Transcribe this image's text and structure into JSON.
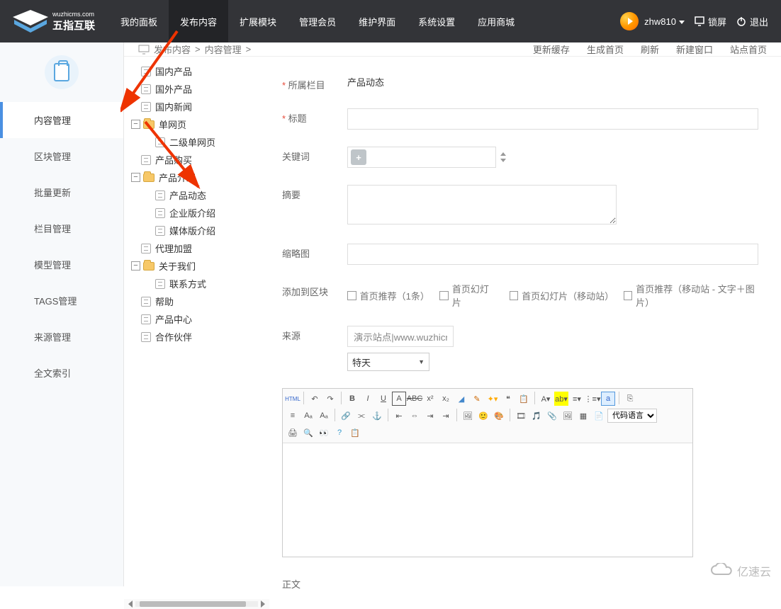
{
  "header": {
    "brand_sub": "wuzhicms.com",
    "brand": "五指互联",
    "nav": [
      "我的面板",
      "发布内容",
      "扩展模块",
      "管理会员",
      "维护界面",
      "系统设置",
      "应用商城"
    ],
    "active_nav": 1,
    "username": "zhw810",
    "lock_label": "锁屏",
    "logout_label": "退出"
  },
  "breadcrumb": [
    "发布内容",
    "内容管理"
  ],
  "sub_actions": [
    "更新缓存",
    "生成首页",
    "刷新",
    "新建窗口",
    "站点首页"
  ],
  "sidebar": {
    "items": [
      "内容管理",
      "区块管理",
      "批量更新",
      "栏目管理",
      "模型管理",
      "TAGS管理",
      "来源管理",
      "全文索引"
    ],
    "active": 0
  },
  "tree": [
    {
      "lvl": 1,
      "ico": "file",
      "label": "国内产品"
    },
    {
      "lvl": 1,
      "ico": "file",
      "label": "国外产品"
    },
    {
      "lvl": 1,
      "ico": "file",
      "label": "国内新闻"
    },
    {
      "lvl": 0,
      "ico": "folder",
      "toggle": "−",
      "label": "单网页"
    },
    {
      "lvl": 2,
      "ico": "file",
      "label": "二级单网页"
    },
    {
      "lvl": 1,
      "ico": "file",
      "label": "产品购买"
    },
    {
      "lvl": 0,
      "ico": "folder",
      "toggle": "−",
      "label": "产品介绍"
    },
    {
      "lvl": 2,
      "ico": "file",
      "label": "产品动态"
    },
    {
      "lvl": 2,
      "ico": "file",
      "label": "企业版介绍"
    },
    {
      "lvl": 2,
      "ico": "file",
      "label": "媒体版介绍"
    },
    {
      "lvl": 1,
      "ico": "file",
      "label": "代理加盟"
    },
    {
      "lvl": 0,
      "ico": "folder",
      "toggle": "−",
      "label": "关于我们"
    },
    {
      "lvl": 2,
      "ico": "file",
      "label": "联系方式"
    },
    {
      "lvl": 1,
      "ico": "file",
      "label": "帮助"
    },
    {
      "lvl": 1,
      "ico": "file",
      "label": "产品中心"
    },
    {
      "lvl": 1,
      "ico": "file",
      "label": "合作伙伴"
    }
  ],
  "form": {
    "category_label": "所属栏目",
    "category_value": "产品动态",
    "title_label": "标题",
    "keywords_label": "关键词",
    "summary_label": "摘要",
    "thumb_label": "缩略图",
    "block_label": "添加到区块",
    "blocks": [
      "首页推荐（1条）",
      "首页幻灯片",
      "首页幻灯片（移动站）",
      "首页推荐（移动站 - 文字＋图片）"
    ],
    "source_label": "来源",
    "source_value": "演示站点|www.wuzhicms",
    "source_select": "特天",
    "body_label": "正文",
    "editor_html_btn": "HTML",
    "editor_codelang": "代码语言"
  },
  "watermark": "亿速云"
}
